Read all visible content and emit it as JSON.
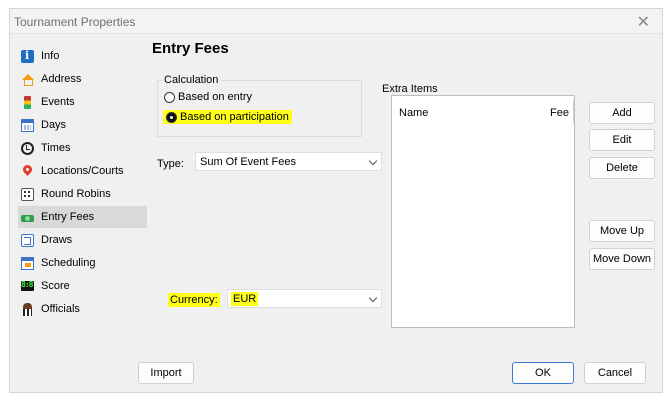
{
  "window": {
    "title": "Tournament Properties",
    "close_glyph": "✕"
  },
  "sidebar": {
    "items": [
      {
        "label": "Info",
        "icon": "info-icon"
      },
      {
        "label": "Address",
        "icon": "house-icon"
      },
      {
        "label": "Events",
        "icon": "events-icon"
      },
      {
        "label": "Days",
        "icon": "calendar-icon"
      },
      {
        "label": "Times",
        "icon": "clock-icon"
      },
      {
        "label": "Locations/Courts",
        "icon": "map-pin-icon"
      },
      {
        "label": "Round Robins",
        "icon": "dice-icon"
      },
      {
        "label": "Entry Fees",
        "icon": "money-icon",
        "selected": true
      },
      {
        "label": "Draws",
        "icon": "bracket-icon"
      },
      {
        "label": "Scheduling",
        "icon": "schedule-icon"
      },
      {
        "label": "Score",
        "icon": "scoreboard-icon"
      },
      {
        "label": "Officials",
        "icon": "referee-icon"
      }
    ]
  },
  "main": {
    "title": "Entry Fees",
    "calculation": {
      "legend": "Calculation",
      "options": [
        {
          "label": "Based on entry",
          "checked": false
        },
        {
          "label": "Based on participation",
          "checked": true
        }
      ]
    },
    "type": {
      "label": "Type:",
      "value": "Sum Of Event Fees"
    },
    "currency": {
      "label": "Currency:",
      "value": "EUR"
    },
    "extra_items": {
      "legend": "Extra Items",
      "columns": [
        "Name",
        "Fee"
      ]
    },
    "buttons": {
      "add": "Add",
      "edit": "Edit",
      "delete": "Delete",
      "move_up": "Move Up",
      "move_down": "Move Down"
    },
    "highlight_color": "#ffff18"
  },
  "footer": {
    "import": "Import",
    "ok": "OK",
    "cancel": "Cancel"
  }
}
